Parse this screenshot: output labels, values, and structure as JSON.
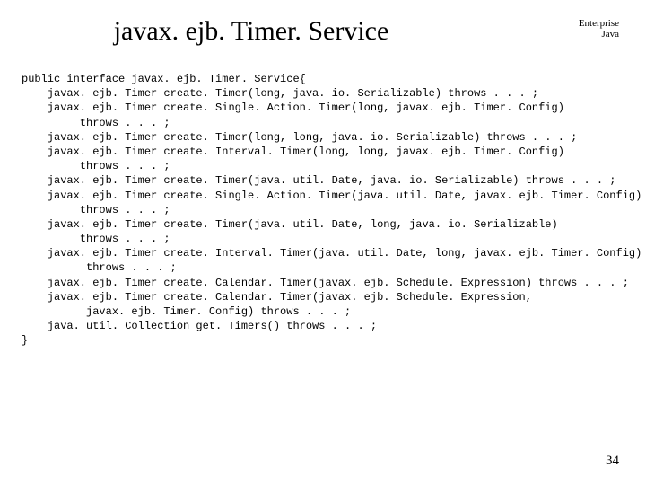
{
  "title": "javax. ejb. Timer. Service",
  "corner": {
    "line1": "Enterprise",
    "line2": "Java"
  },
  "code": "public interface javax. ejb. Timer. Service{\n    javax. ejb. Timer create. Timer(long, java. io. Serializable) throws . . . ;\n    javax. ejb. Timer create. Single. Action. Timer(long, javax. ejb. Timer. Config)\n         throws . . . ;\n    javax. ejb. Timer create. Timer(long, long, java. io. Serializable) throws . . . ;\n    javax. ejb. Timer create. Interval. Timer(long, long, javax. ejb. Timer. Config)\n         throws . . . ;\n    javax. ejb. Timer create. Timer(java. util. Date, java. io. Serializable) throws . . . ;\n    javax. ejb. Timer create. Single. Action. Timer(java. util. Date, javax. ejb. Timer. Config)\n         throws . . . ;\n    javax. ejb. Timer create. Timer(java. util. Date, long, java. io. Serializable)\n         throws . . . ;\n    javax. ejb. Timer create. Interval. Timer(java. util. Date, long, javax. ejb. Timer. Config)\n          throws . . . ;\n    javax. ejb. Timer create. Calendar. Timer(javax. ejb. Schedule. Expression) throws . . . ;\n    javax. ejb. Timer create. Calendar. Timer(javax. ejb. Schedule. Expression,\n          javax. ejb. Timer. Config) throws . . . ;\n    java. util. Collection get. Timers() throws . . . ;\n}",
  "pagenum": "34"
}
